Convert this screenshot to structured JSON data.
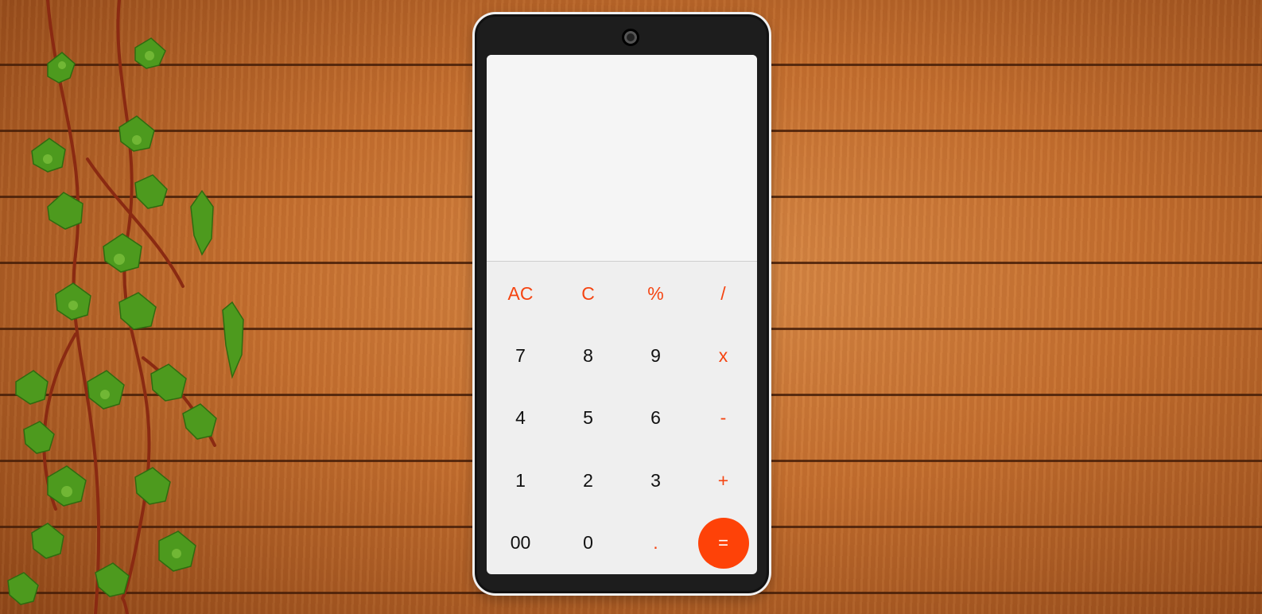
{
  "calculator": {
    "display": {
      "expression": "",
      "result": ""
    },
    "keys": [
      {
        "name": "key-all-clear",
        "label": "AC",
        "kind": "op"
      },
      {
        "name": "key-clear",
        "label": "C",
        "kind": "op"
      },
      {
        "name": "key-percent",
        "label": "%",
        "kind": "op"
      },
      {
        "name": "key-divide",
        "label": "/",
        "kind": "op"
      },
      {
        "name": "key-7",
        "label": "7",
        "kind": "num"
      },
      {
        "name": "key-8",
        "label": "8",
        "kind": "num"
      },
      {
        "name": "key-9",
        "label": "9",
        "kind": "num"
      },
      {
        "name": "key-multiply",
        "label": "x",
        "kind": "op"
      },
      {
        "name": "key-4",
        "label": "4",
        "kind": "num"
      },
      {
        "name": "key-5",
        "label": "5",
        "kind": "num"
      },
      {
        "name": "key-6",
        "label": "6",
        "kind": "num"
      },
      {
        "name": "key-subtract",
        "label": "-",
        "kind": "op"
      },
      {
        "name": "key-1",
        "label": "1",
        "kind": "num"
      },
      {
        "name": "key-2",
        "label": "2",
        "kind": "num"
      },
      {
        "name": "key-3",
        "label": "3",
        "kind": "num"
      },
      {
        "name": "key-add",
        "label": "+",
        "kind": "op"
      },
      {
        "name": "key-double-zero",
        "label": "00",
        "kind": "num"
      },
      {
        "name": "key-0",
        "label": "0",
        "kind": "num"
      },
      {
        "name": "key-decimal",
        "label": ".",
        "kind": "dot"
      },
      {
        "name": "key-equals",
        "label": "=",
        "kind": "eq"
      }
    ]
  },
  "colors": {
    "accent": "#fe4208",
    "operator_text": "#f54411",
    "keypad_bg": "#efefef",
    "display_bg": "#f5f5f5",
    "phone_body": "#1d1d1d"
  },
  "icons": {
    "camera": "camera-icon",
    "decoration": "ivy-vine-decoration"
  }
}
